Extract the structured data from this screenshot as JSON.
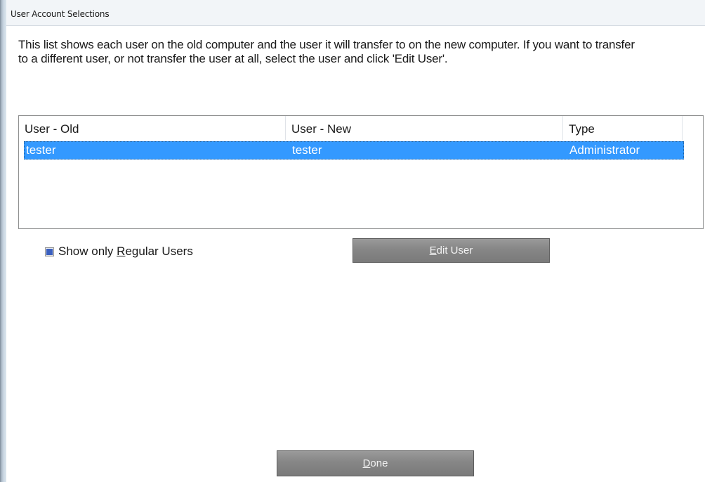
{
  "window": {
    "title": "User Account Selections"
  },
  "description": "This list shows each user on the old computer and the user it will transfer to on the new computer. If you want to transfer to a different user, or not transfer the user at all, select the user and click 'Edit User'.",
  "user_list": {
    "columns": [
      "User - Old",
      "User - New",
      "Type"
    ],
    "rows": [
      {
        "old": "tester",
        "new": "tester",
        "type": "Administrator",
        "selected": true
      }
    ]
  },
  "filter": {
    "label_pre": "Show only ",
    "label_accel": "R",
    "label_post": "egular Users",
    "checked": true
  },
  "buttons": {
    "edit_accel": "E",
    "edit_rest": "dit User",
    "done_accel": "D",
    "done_rest": "one"
  },
  "colors": {
    "selection": "#3399ff",
    "button": "#868686",
    "checkbox_mark": "#3a5fbf"
  },
  "icons": {
    "checkbox_mark": "check-icon"
  }
}
